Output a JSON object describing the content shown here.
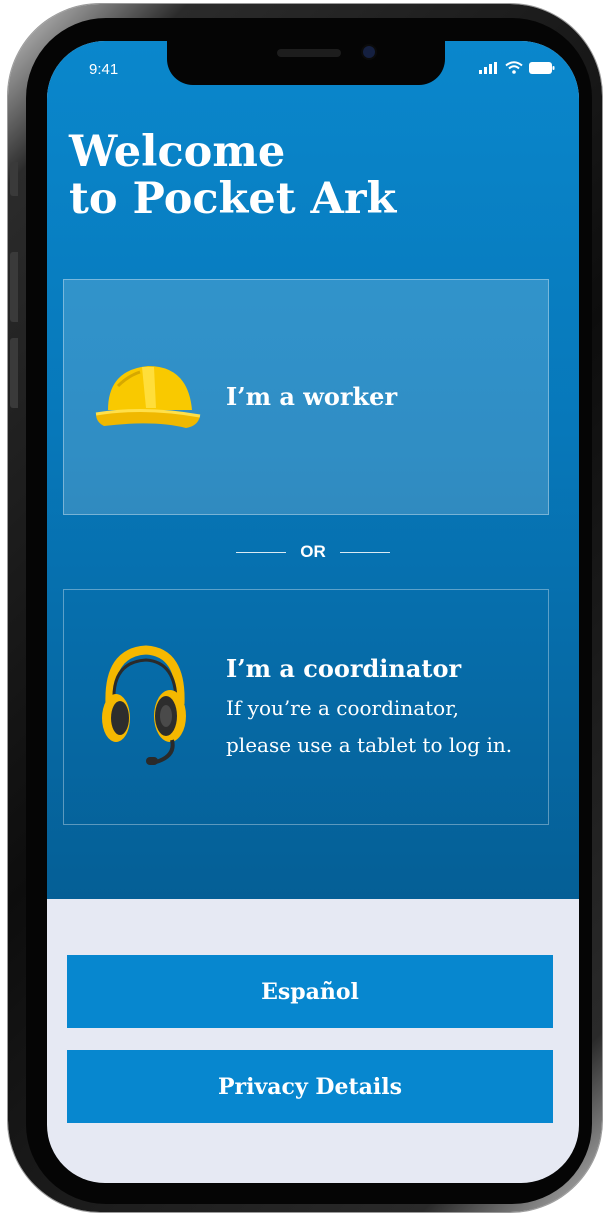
{
  "status_bar": {
    "time": "9:41"
  },
  "welcome": {
    "line1": "Welcome",
    "line2": "to Pocket Ark"
  },
  "worker_card": {
    "label": "I’m a worker",
    "icon": "hard-hat-icon"
  },
  "divider": {
    "text": "OR"
  },
  "coordinator_card": {
    "title": "I’m a coordinator",
    "description": "If you’re a coordinator, please use a tablet to log in.",
    "icon": "headset-icon"
  },
  "buttons": {
    "spanish": "Español",
    "privacy": "Privacy Details"
  },
  "colors": {
    "primary": "#0787cf",
    "background_blue_top": "#0a87cc",
    "background_blue_bottom": "#055f96",
    "bottom_panel": "#e6e9f3",
    "accent_yellow": "#f9c900"
  }
}
